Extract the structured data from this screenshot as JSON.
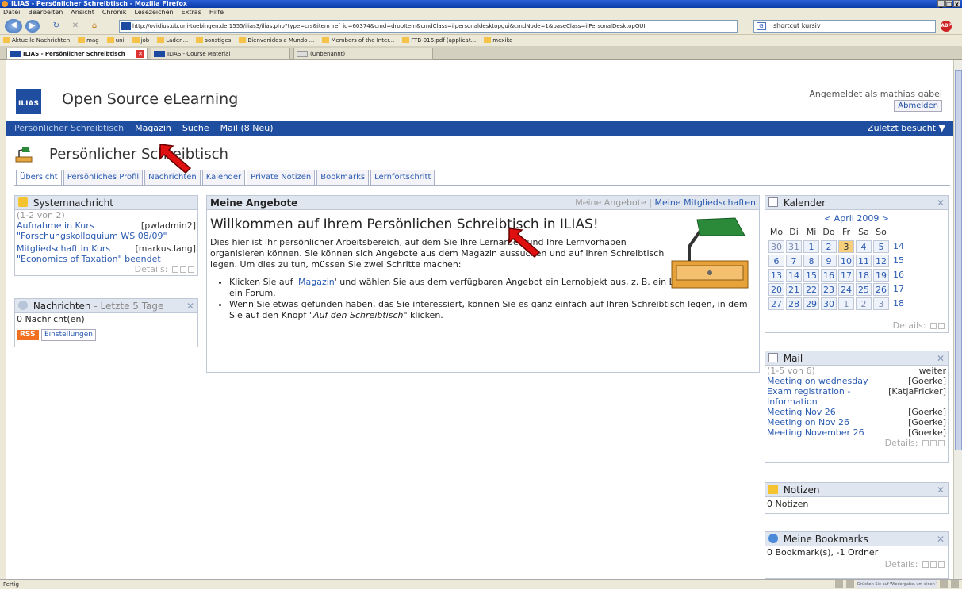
{
  "browser": {
    "title": "ILIAS - Persönlicher Schreibtisch - Mozilla Firefox",
    "window_buttons": [
      "_",
      "□",
      "x"
    ],
    "menu": [
      "Datei",
      "Bearbeiten",
      "Ansicht",
      "Chronik",
      "Lesezeichen",
      "Extras",
      "Hilfe"
    ],
    "url": "http://ovidius.ub.uni-tuebingen.de:1555/ilias3/ilias.php?type=crs&item_ref_id=60374&cmd=dropItem&cmdClass=ilpersonaldesktopgui&cmdNode=1&baseClass=ilPersonalDesktopGUI",
    "search_value": "shortcut kursiv",
    "bookmarks": [
      "Aktuelle Nachrichten",
      "mag",
      "uni",
      "job",
      "Laden...",
      "sonstiges",
      "Bienvenidos a Mundo ...",
      "Members of the Inter...",
      "FTB-016.pdf (applicat...",
      "mexiko"
    ],
    "tabs": [
      "ILIAS - Persönlicher Schreibtisch",
      "ILIAS - Course Material",
      "(Unbenannt)"
    ],
    "status": "Fertig",
    "status_right": "Drücken Sie auf Wiedergabe, um einen Tagcode zu hören"
  },
  "header": {
    "logo_text": "ILIAS",
    "site_name": "Open Source eLearning",
    "logged_in": "Angemeldet als mathias gabel",
    "logout": "Abmelden"
  },
  "mainnav": {
    "items": [
      "Persönlicher Schreibtisch",
      "Magazin",
      "Suche",
      "Mail (8 Neu)"
    ],
    "recent": "Zuletzt besucht ▼"
  },
  "page": {
    "title": "Persönlicher Schreibtisch",
    "subtabs": [
      "Übersicht",
      "Persönliches Profil",
      "Nachrichten",
      "Kalender",
      "Private Notizen",
      "Bookmarks",
      "Lernfortschritt"
    ]
  },
  "system": {
    "title": "Systemnachricht",
    "count": "(1-2 von 2)",
    "items": [
      {
        "line1": "Aufnahme in Kurs",
        "line2": "\"Forschungskolloquium WS 08/09\"",
        "user": "[pwladmin2]"
      },
      {
        "line1": "Mitgliedschaft in Kurs",
        "line2": "\"Economics of Taxation\" beendet",
        "user": "[markus.lang]"
      }
    ],
    "details": "Details:"
  },
  "news": {
    "title": "Nachrichten",
    "suffix": "- Letzte 5 Tage",
    "count": "0 Nachricht(en)",
    "rss": "RSS",
    "settings": "Einstellungen"
  },
  "offers": {
    "title": "Meine Angebote",
    "tab_offers": "Meine Angebote",
    "separator": "|",
    "tab_memberships": "Meine Mitgliedschaften",
    "welcome": "Willkommen auf Ihrem Persönlichen Schreibtisch in ILIAS!",
    "intro": "Dies hier ist Ihr persönlicher Arbeitsbereich, auf dem Sie Ihre Lernarbeit und Ihre Lernvorhaben organisieren können. Sie können sich Angebote aus dem Magazin aussuchen und auf Ihren Schreibtisch legen. Um dies zu tun, müssen Sie zwei Schritte machen:",
    "bullet1_a": "Klicken Sie auf '",
    "bullet1_link": "Magazin",
    "bullet1_b": "' und wählen Sie aus dem verfügbaren Angebot ein Lernobjekt aus, z. B. ein Lernmodul oder ein Forum.",
    "bullet2_a": "Wenn Sie etwas gefunden haben, das Sie interessiert, können Sie es ganz einfach auf Ihren Schreibtisch legen, in dem Sie auf den Knopf \"",
    "bullet2_em": "Auf den Schreibtisch",
    "bullet2_b": "\" klicken."
  },
  "calendar": {
    "title": "Kalender",
    "month": "< April 2009 >",
    "weekdays": [
      "Mo",
      "Di",
      "Mi",
      "Do",
      "Fr",
      "Sa",
      "So"
    ],
    "weeks": [
      [
        "30",
        "31",
        "1",
        "2",
        "3",
        "4",
        "5",
        "14"
      ],
      [
        "6",
        "7",
        "8",
        "9",
        "10",
        "11",
        "12",
        "15"
      ],
      [
        "13",
        "14",
        "15",
        "16",
        "17",
        "18",
        "19",
        "16"
      ],
      [
        "20",
        "21",
        "22",
        "23",
        "24",
        "25",
        "26",
        "17"
      ],
      [
        "27",
        "28",
        "29",
        "30",
        "1",
        "2",
        "3",
        "18"
      ]
    ],
    "details": "Details:"
  },
  "mail": {
    "title": "Mail",
    "count": "(1-5 von 6)",
    "more": "weiter",
    "items": [
      {
        "subject": "Meeting on wednesday",
        "from": "[Goerke]"
      },
      {
        "subject": "Exam registration - Information",
        "from": "[KatjaFricker]"
      },
      {
        "subject": "Meeting Nov 26",
        "from": "[Goerke]"
      },
      {
        "subject": "Meeting on Nov 26",
        "from": "[Goerke]"
      },
      {
        "subject": "Meeting November 26",
        "from": "[Goerke]"
      }
    ],
    "details": "Details:"
  },
  "notes": {
    "title": "Notizen",
    "count": "0 Notizen"
  },
  "bookmarks_block": {
    "title": "Meine Bookmarks",
    "count": "0 Bookmark(s), -1 Ordner",
    "details": "Details:"
  }
}
